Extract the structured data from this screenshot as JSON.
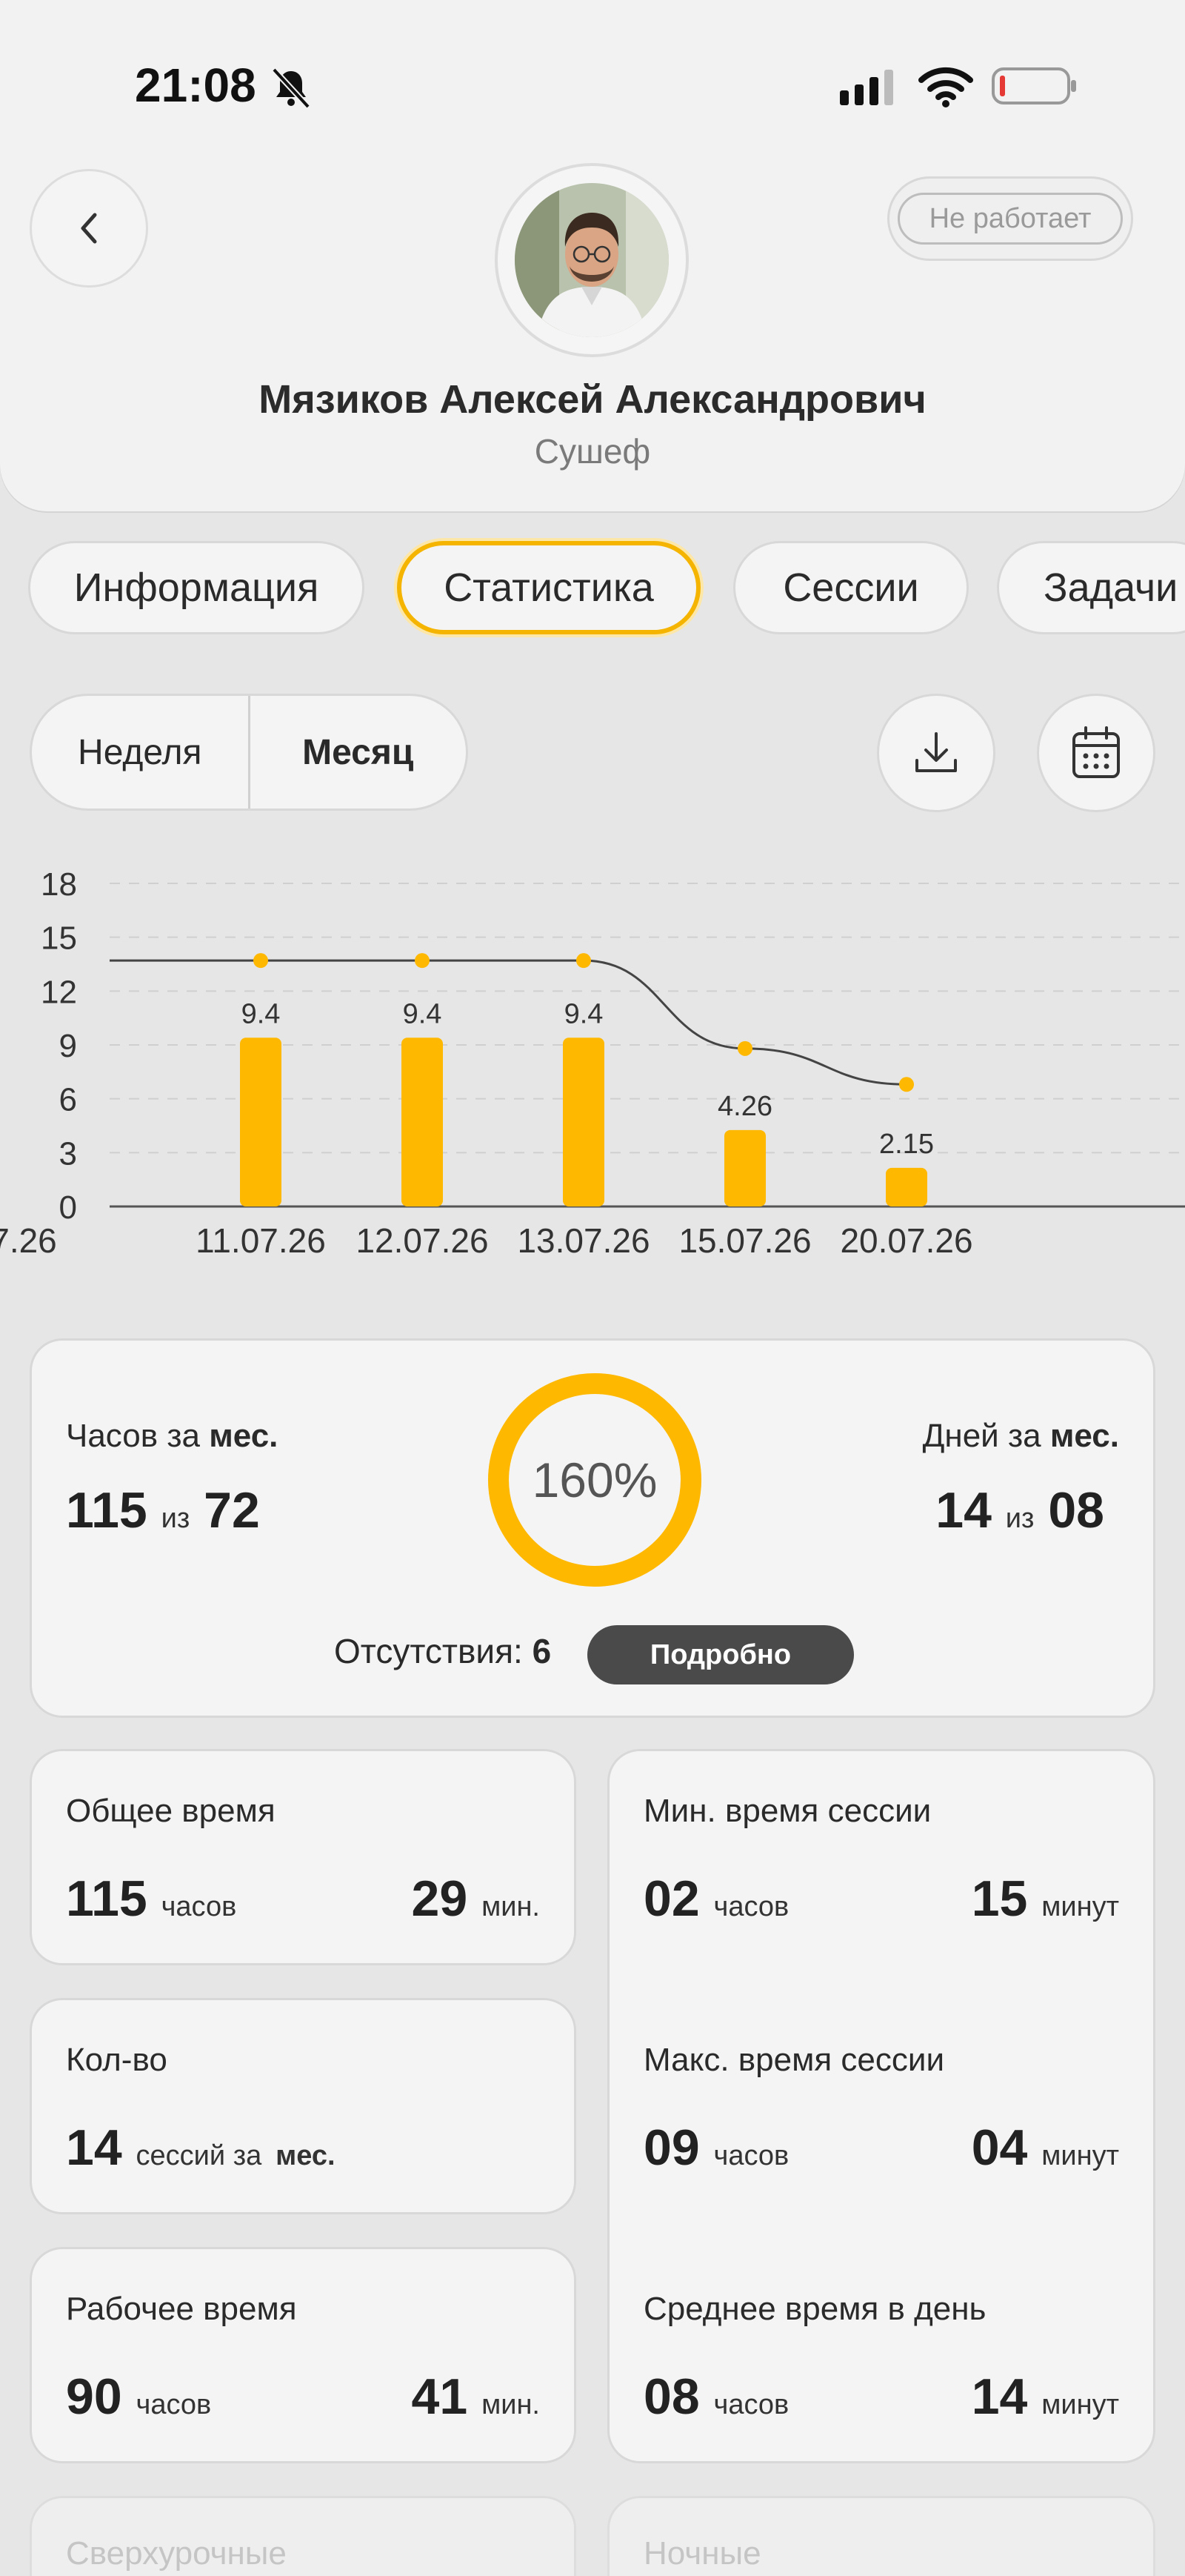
{
  "status_bar": {
    "time": "21:08"
  },
  "profile": {
    "name": "Мязиков Алексей Александрович",
    "role": "Сушеф",
    "status": "Не работает"
  },
  "tabs": [
    {
      "label": "Информация",
      "active": false
    },
    {
      "label": "Статистика",
      "active": true
    },
    {
      "label": "Сессии",
      "active": false
    },
    {
      "label": "Задачи",
      "active": false
    }
  ],
  "period": {
    "week": "Неделя",
    "month": "Месяц",
    "selected": "Месяц"
  },
  "colors": {
    "accent": "#ffb800",
    "dark_button": "#4a4a4a"
  },
  "chart_data": {
    "type": "bar",
    "categories": [
      "7.26",
      "11.07.26",
      "12.07.26",
      "13.07.26",
      "15.07.26",
      "20.07.26"
    ],
    "values": [
      null,
      9.4,
      9.4,
      9.4,
      4.26,
      2.15
    ],
    "data_labels": [
      "",
      "9.4",
      "9.4",
      "9.4",
      "4.26",
      "2.15"
    ],
    "line_series": [
      13.7,
      13.7,
      13.7,
      13.7,
      8.8,
      6.8
    ],
    "yticks": [
      "18",
      "15",
      "12",
      "9",
      "6",
      "3",
      "0"
    ],
    "ylim": [
      0,
      18
    ],
    "grid": true
  },
  "summary": {
    "hours_label": "Часов за",
    "hours_label_bold": "мес.",
    "hours_value": "115",
    "hours_of": "из",
    "hours_total": "72",
    "percent": "160%",
    "percent_value": 1.0,
    "days_label": "Дней за",
    "days_label_bold": "мес.",
    "days_value": "14",
    "days_of": "из",
    "days_total": "08",
    "absences_label": "Отсутствия:",
    "absences_value": "6",
    "details_button": "Подробно"
  },
  "stats": {
    "total_time": {
      "title": "Общее время",
      "hours": "115",
      "hours_unit": "часов",
      "minutes": "29",
      "minutes_unit": "мин."
    },
    "count": {
      "title": "Кол-во",
      "value": "14",
      "unit": "сессий за",
      "unit_bold": "мес."
    },
    "work_time": {
      "title": "Рабочее время",
      "hours": "90",
      "hours_unit": "часов",
      "minutes": "41",
      "minutes_unit": "мин."
    },
    "min_session": {
      "title": "Мин. время сессии",
      "hours": "02",
      "hours_unit": "часов",
      "minutes": "15",
      "minutes_unit": "минут"
    },
    "max_session": {
      "title": "Макс. время сессии",
      "hours": "09",
      "hours_unit": "часов",
      "minutes": "04",
      "minutes_unit": "минут"
    },
    "avg_day": {
      "title": "Среднее время в день",
      "hours": "08",
      "hours_unit": "часов",
      "minutes": "14",
      "minutes_unit": "минут"
    },
    "overtime": {
      "title": "Сверхурочные"
    },
    "night": {
      "title": "Ночные"
    }
  }
}
